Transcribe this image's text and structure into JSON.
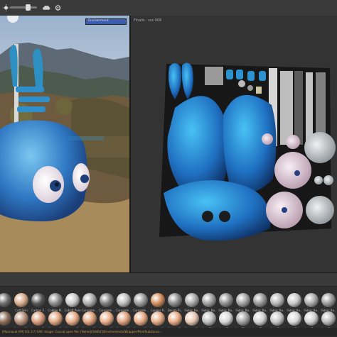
{
  "colors": {
    "accent": "#3a5db0",
    "status_text": "#c79a52"
  },
  "toolbar": {
    "icons": [
      "sun-icon",
      "slider-icon",
      "cloud-icon",
      "settings-icon"
    ]
  },
  "viewport3d": {
    "env_label": "Environment"
  },
  "uv_view": {
    "title": "Finalis.. sss 008"
  },
  "shelf_row1": [
    {
      "label": "",
      "color": "#6d6d6d"
    },
    {
      "label": "Calf Skin",
      "color": "#d7a98a"
    },
    {
      "label": "Carbon F..",
      "color": "#555555"
    },
    {
      "label": "Cobble M..",
      "color": "#898989"
    },
    {
      "label": "Cobalt Pure",
      "color": "#c9c9c9"
    },
    {
      "label": "Concrete ..",
      "color": "#aaaaaa"
    },
    {
      "label": "Concrete ..",
      "color": "#7d7d7d"
    },
    {
      "label": "Concrete ..",
      "color": "#bdbdbd"
    },
    {
      "label": "Concrete ..",
      "color": "#999999"
    },
    {
      "label": "Copper P..",
      "color": "#d08c5a"
    },
    {
      "label": "Denim Ri..",
      "color": "#8a8a8a"
    },
    {
      "label": "Fabric Ba..",
      "color": "#a7a7a7"
    },
    {
      "label": "Fabric Ba..",
      "color": "#9d9d9d"
    },
    {
      "label": "Fabric Ba..",
      "color": "#8e8e8e"
    },
    {
      "label": "Fabric Ba..",
      "color": "#a0a0a0"
    },
    {
      "label": "Fabric Ba..",
      "color": "#959595"
    },
    {
      "label": "Fabric Ba..",
      "color": "#b4b4b4"
    },
    {
      "label": "Fabric Ba..",
      "color": "#c7c7c7"
    },
    {
      "label": "Fabric Ba..",
      "color": "#a9a9a9"
    },
    {
      "label": "Fabric Ba..",
      "color": "#9a9a9a"
    }
  ],
  "shelf_row2": [
    {
      "label": "",
      "color": "#8a6c58"
    },
    {
      "label": "Human B..",
      "color": "#b8907a"
    },
    {
      "label": "Human B..",
      "color": "#d89a7a"
    },
    {
      "label": "Human F..",
      "color": "#e0a47f"
    },
    {
      "label": "Human F..",
      "color": "#e6ab86"
    },
    {
      "label": "Human M..",
      "color": "#dfa17c"
    },
    {
      "label": "Human M..",
      "color": "#e8ad87"
    },
    {
      "label": "Human M..",
      "color": "#dd9f7c"
    },
    {
      "label": "Human M..",
      "color": "#e6a985"
    },
    {
      "label": "Human N..",
      "color": "#e4a983"
    },
    {
      "label": "Human S..",
      "color": "#e7aa86"
    },
    {
      "label": "Human S..",
      "color": "#e8c7b2"
    },
    {
      "label": "Iron Chl..",
      "color": "#bcbcbc"
    },
    {
      "label": "Iron Cor..",
      "color": "#d6d6d6"
    },
    {
      "label": "Iron Diam..",
      "color": "#9f9f9f"
    },
    {
      "label": "Iron Fine..",
      "color": "#d0d0d0"
    },
    {
      "label": "Iron Gal..",
      "color": "#c4c4c4"
    },
    {
      "label": "Iron Gri..",
      "color": "#d9d9d9"
    },
    {
      "label": "Iron Pure",
      "color": "#cfcfcf"
    },
    {
      "label": "Iron Rou..",
      "color": "#b9b9b9"
    }
  ],
  "status_bar": {
    "text": "[Marmoset API] [GL 3.?] SAE: Image: Cannot open file: [Home]/[SHELF]/Environments/Wrapper/Pilot/Substance..."
  }
}
